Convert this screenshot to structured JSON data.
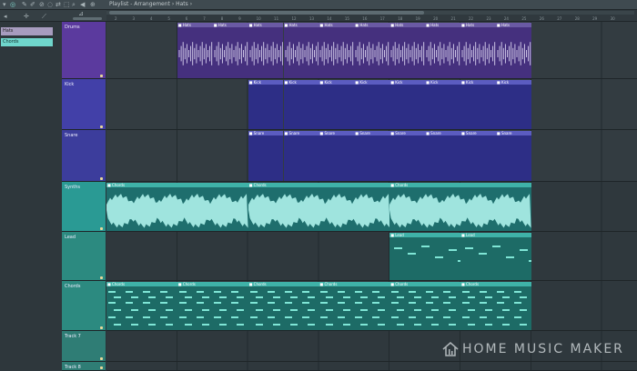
{
  "title": "Playlist - Arrangement › Hats ›",
  "left_panel": {
    "items": [
      "Hats",
      "Chords"
    ]
  },
  "ruler_numbers": [
    "2",
    "3",
    "4",
    "5",
    "6",
    "7",
    "8",
    "9",
    "10",
    "11",
    "12",
    "13",
    "14",
    "15",
    "16",
    "17",
    "18",
    "19",
    "20",
    "21",
    "22",
    "23",
    "24",
    "25",
    "26",
    "27",
    "28",
    "29",
    "30"
  ],
  "tracks": [
    {
      "name": "Drums",
      "color": "#5b3a9e"
    },
    {
      "name": "Kick",
      "color": "#4240a8"
    },
    {
      "name": "Snare",
      "color": "#3c3d9c"
    },
    {
      "name": "Synths",
      "color": "#2a9a94"
    },
    {
      "name": "Lead",
      "color": "#2c8a80"
    },
    {
      "name": "Chords",
      "color": "#2c8a80"
    },
    {
      "name": "Track 7",
      "color": "#2f7d75"
    },
    {
      "name": "Track 8",
      "color": "#2f7d75"
    }
  ],
  "clips": {
    "hats_label": "Hats",
    "kick_label": "Kick",
    "snare_label": "Snare",
    "chords_label": "Chords",
    "lead_label": "Lead"
  },
  "watermark": "HOME MUSIC MAKER",
  "colors": {
    "hats_clip": "#45307e",
    "kick_clip": "#2d2e86",
    "synth_clip": "#1e6e6d",
    "wave": "#9fe4de",
    "notes": "#7fe6d6"
  }
}
